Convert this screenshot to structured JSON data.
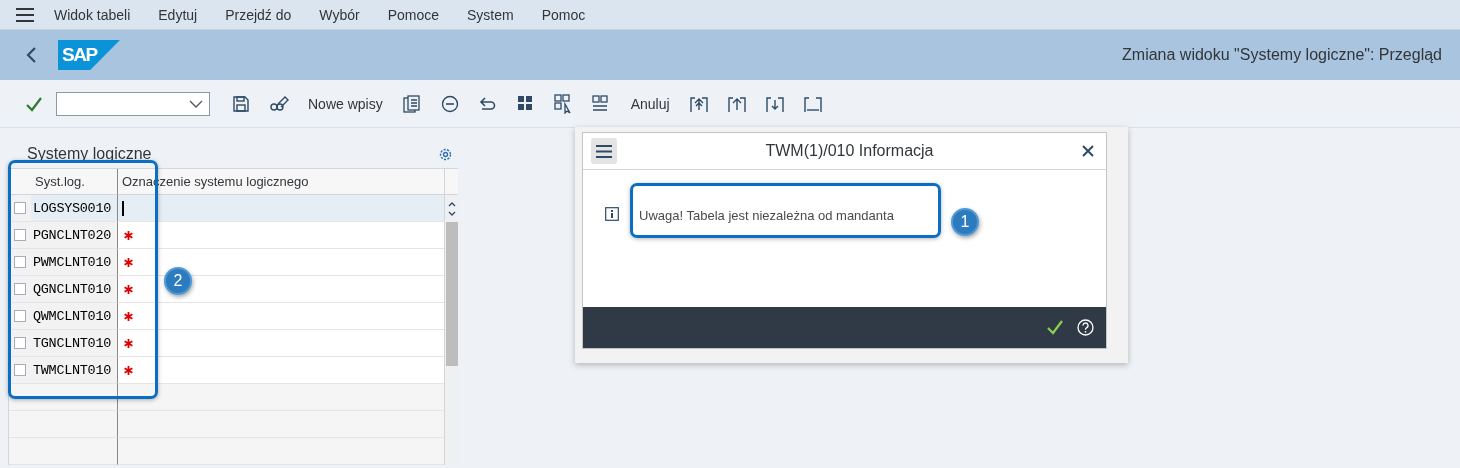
{
  "menu": {
    "items": [
      "Widok tabeli",
      "Edytuj",
      "Przejdź do",
      "Wybór",
      "Pomoce",
      "System",
      "Pomoc"
    ]
  },
  "header": {
    "logo": "SAP",
    "title": "Zmiana widoku \"Systemy logiczne\": Przegląd"
  },
  "toolbar": {
    "new_entries": "Nowe wpisy",
    "cancel": "Anuluj"
  },
  "table": {
    "title": "Systemy logiczne",
    "columns": [
      "Syst.log.",
      "Oznaczenie systemu logicznego"
    ],
    "rows": [
      {
        "system": "LOGSYS0010",
        "checked": false,
        "selected": true,
        "required": false
      },
      {
        "system": "PGNCLNT020",
        "checked": false,
        "selected": false,
        "required": true
      },
      {
        "system": "PWMCLNT010",
        "checked": false,
        "selected": false,
        "required": true
      },
      {
        "system": "QGNCLNT010",
        "checked": false,
        "selected": false,
        "required": true
      },
      {
        "system": "QWMCLNT010",
        "checked": false,
        "selected": false,
        "required": true
      },
      {
        "system": "TGNCLNT010",
        "checked": false,
        "selected": false,
        "required": true
      },
      {
        "system": "TWMCLNT010",
        "checked": false,
        "selected": false,
        "required": true
      }
    ]
  },
  "dialog": {
    "title": "TWM(1)/010 Informacja",
    "message": "Uwaga! Tabela jest niezależna od mandanta"
  },
  "callouts": [
    {
      "number": "1"
    },
    {
      "number": "2"
    }
  ]
}
